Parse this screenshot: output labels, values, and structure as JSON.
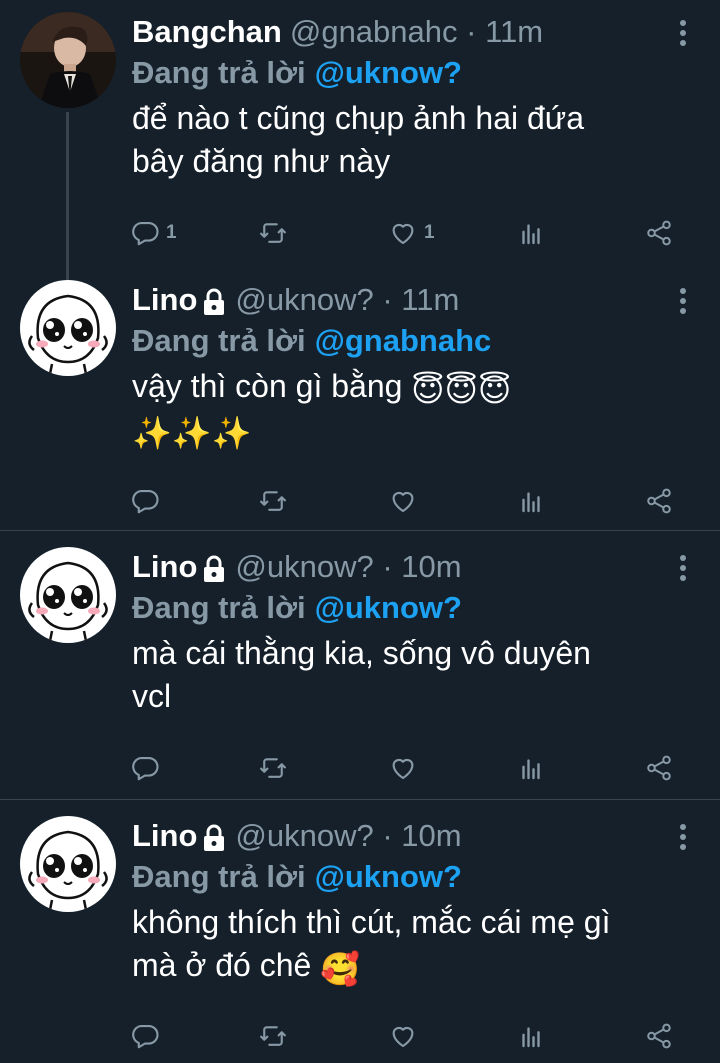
{
  "tweets": [
    {
      "name": "Bangchan",
      "handle": "@gnabnahc · 11m",
      "locked": false,
      "reply_prefix": "Đang trả lời",
      "reply_to": "@uknow?",
      "lines": [
        "để nào t cũng chụp ảnh hai đứa",
        "bây đăng như này"
      ],
      "reply_count": "1",
      "like_count": "1"
    },
    {
      "name": "Lino",
      "handle": "@uknow? · 11m",
      "locked": true,
      "reply_prefix": "Đang trả lời",
      "reply_to": "@gnabnahc",
      "lines": [
        "vậy thì còn gì bằng"
      ],
      "emoji_line1": "😇😇😇",
      "emoji_line2": "✨✨✨",
      "reply_count": "",
      "like_count": ""
    },
    {
      "name": "Lino",
      "handle": "@uknow? · 10m",
      "locked": true,
      "reply_prefix": "Đang trả lời",
      "reply_to": "@uknow?",
      "lines": [
        "mà cái thằng kia, sống vô duyên",
        "vcl"
      ],
      "reply_count": "",
      "like_count": ""
    },
    {
      "name": "Lino",
      "handle": "@uknow? · 10m",
      "locked": true,
      "reply_prefix": "Đang trả lời",
      "reply_to": "@uknow?",
      "lines": [
        "không thích thì cút, mắc cái mẹ gì",
        "mà ở đó chê"
      ],
      "emoji_line2": "🥰",
      "reply_count": "",
      "like_count": ""
    }
  ],
  "icons": {
    "reply": "reply-icon",
    "retweet": "retweet-icon",
    "like": "heart-icon",
    "analytics": "analytics-icon",
    "share": "share-icon",
    "more": "more-options-icon",
    "lock": "lock-icon"
  },
  "colors": {
    "background": "#15202b",
    "secondary_text": "#8899a6",
    "mention": "#1da1f2",
    "divider": "#38444d"
  }
}
